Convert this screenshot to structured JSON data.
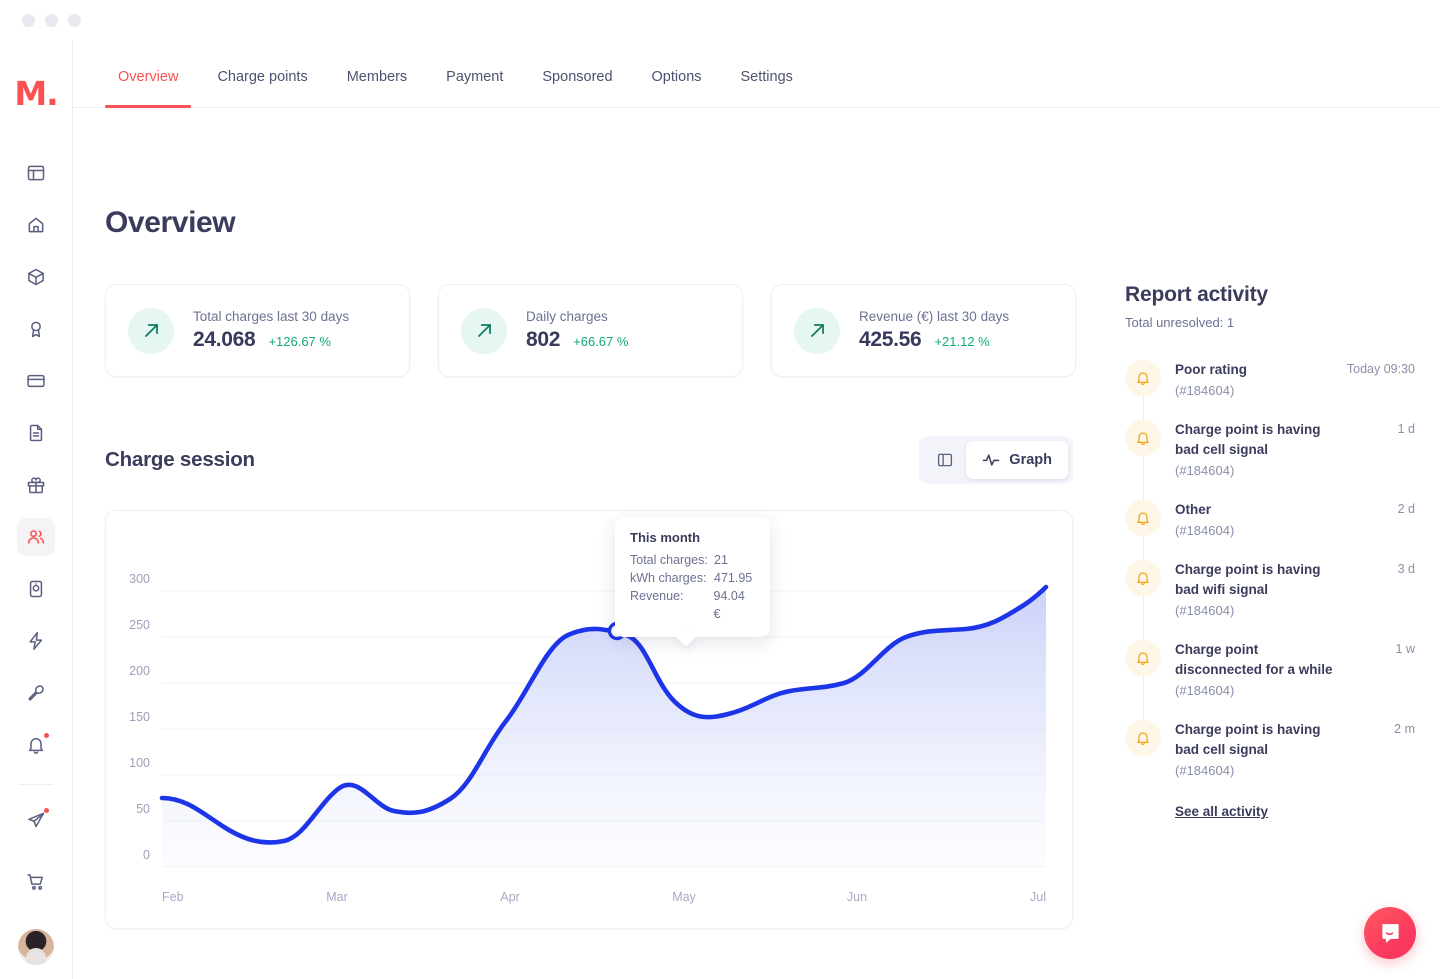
{
  "window": {
    "dots": [
      "close",
      "minimize",
      "maximize"
    ]
  },
  "brand": {
    "logo_text": "M.",
    "logo_color": "#fa5252"
  },
  "topnav": {
    "tabs": [
      {
        "label": "Overview",
        "active": true
      },
      {
        "label": "Charge points",
        "active": false
      },
      {
        "label": "Members",
        "active": false
      },
      {
        "label": "Payment",
        "active": false
      },
      {
        "label": "Sponsored",
        "active": false
      },
      {
        "label": "Options",
        "active": false
      },
      {
        "label": "Settings",
        "active": false
      }
    ]
  },
  "sidebar": {
    "items": [
      {
        "icon": "layout-icon",
        "active": false,
        "badge": false
      },
      {
        "icon": "home-icon",
        "active": false,
        "badge": false
      },
      {
        "icon": "box-icon",
        "active": false,
        "badge": false
      },
      {
        "icon": "award-icon",
        "active": false,
        "badge": false
      },
      {
        "icon": "credit-card-icon",
        "active": false,
        "badge": false
      },
      {
        "icon": "document-icon",
        "active": false,
        "badge": false
      },
      {
        "icon": "gift-icon",
        "active": false,
        "badge": false
      },
      {
        "icon": "users-icon",
        "active": true,
        "badge": false
      },
      {
        "icon": "charge-point-icon",
        "active": false,
        "badge": false
      },
      {
        "icon": "bolt-icon",
        "active": false,
        "badge": false
      },
      {
        "icon": "wrench-icon",
        "active": false,
        "badge": false
      },
      {
        "icon": "bell-icon",
        "active": false,
        "badge": true
      }
    ],
    "below_divider": [
      {
        "icon": "send-icon",
        "active": false,
        "badge": true
      }
    ],
    "bottom": [
      {
        "icon": "cart-icon",
        "active": false,
        "badge": false
      }
    ],
    "avatar": "user-avatar"
  },
  "page": {
    "title": "Overview"
  },
  "stats": [
    {
      "icon": "arrow-up-right-icon",
      "label": "Total charges last 30 days",
      "value": "24.068",
      "delta": "+126.67 %"
    },
    {
      "icon": "arrow-up-right-icon",
      "label": "Daily charges",
      "value": "802",
      "delta": "+66.67 %"
    },
    {
      "icon": "arrow-up-right-icon",
      "label": "Revenue (€) last 30 days",
      "value": "425.56",
      "delta": "+21.12 %"
    }
  ],
  "charge_session": {
    "title": "Charge session",
    "view_toggle": {
      "table_icon": "columns-icon",
      "graph_icon": "activity-icon",
      "graph_label": "Graph",
      "selected": "Graph"
    },
    "tooltip": {
      "title": "This month",
      "rows": [
        {
          "key": "Total charges:",
          "value": "21"
        },
        {
          "key": "kWh charges:",
          "value": "471.95"
        },
        {
          "key": "Revenue:",
          "value": "94.04 €"
        }
      ]
    }
  },
  "chart_data": {
    "type": "area",
    "title": "Charge session",
    "xlabel": "",
    "ylabel": "",
    "x": [
      "Feb",
      "Mar",
      "Apr",
      "May",
      "Jun",
      "Jul"
    ],
    "xticks": [
      "Feb",
      "Mar",
      "Apr",
      "May",
      "Jun",
      "Jul"
    ],
    "yticks": [
      0,
      50,
      100,
      150,
      200,
      250,
      300
    ],
    "ylim": [
      0,
      320
    ],
    "grid": true,
    "legend": false,
    "line_color": "#1d35e8",
    "fill_color": "#dfe3fb",
    "series": [
      {
        "name": "Charge sessions",
        "points": [
          {
            "x": "Feb",
            "y": 72
          },
          {
            "x": "Feb 0.35",
            "y": 48
          },
          {
            "x": "Feb 0.7",
            "y": 29
          },
          {
            "x": "Mar",
            "y": 110
          },
          {
            "x": "Mar 0.4",
            "y": 68
          },
          {
            "x": "Mar 0.8",
            "y": 63
          },
          {
            "x": "Apr",
            "y": 145
          },
          {
            "x": "Apr 0.45",
            "y": 242
          },
          {
            "x": "Apr 0.8",
            "y": 252
          },
          {
            "x": "May",
            "y": 185
          },
          {
            "x": "May 0.4",
            "y": 176
          },
          {
            "x": "May 0.8",
            "y": 205
          },
          {
            "x": "Jun",
            "y": 222
          },
          {
            "x": "Jun 0.6",
            "y": 232
          },
          {
            "x": "Jul",
            "y": 268
          }
        ]
      }
    ],
    "marker": {
      "x": "Apr 0.82",
      "y": 247,
      "label": "This month"
    },
    "annotation": {
      "title": "This month",
      "total_charges": 21,
      "kwh_charges": 471.95,
      "revenue": "94.04 €"
    }
  },
  "activity": {
    "title": "Report activity",
    "subtitle": "Total unresolved: 1",
    "items": [
      {
        "icon": "bell-icon",
        "title": "Poor rating",
        "id": "(#184604)",
        "time": "Today 09:30"
      },
      {
        "icon": "bell-icon",
        "title": "Charge point is having bad cell signal",
        "id": "(#184604)",
        "time": "1 d"
      },
      {
        "icon": "bell-icon",
        "title": "Other",
        "id": "(#184604)",
        "time": "2 d"
      },
      {
        "icon": "bell-icon",
        "title": "Charge point is having bad wifi signal",
        "id": "(#184604)",
        "time": "3 d"
      },
      {
        "icon": "bell-icon",
        "title": "Charge point disconnected for a while",
        "id": "(#184604)",
        "time": "1 w"
      },
      {
        "icon": "bell-icon",
        "title": "Charge point is having bad cell signal",
        "id": "(#184604)",
        "time": "2 m"
      }
    ],
    "see_all_label": "See all activity"
  },
  "chat": {
    "icon": "intercom-chat-icon"
  }
}
